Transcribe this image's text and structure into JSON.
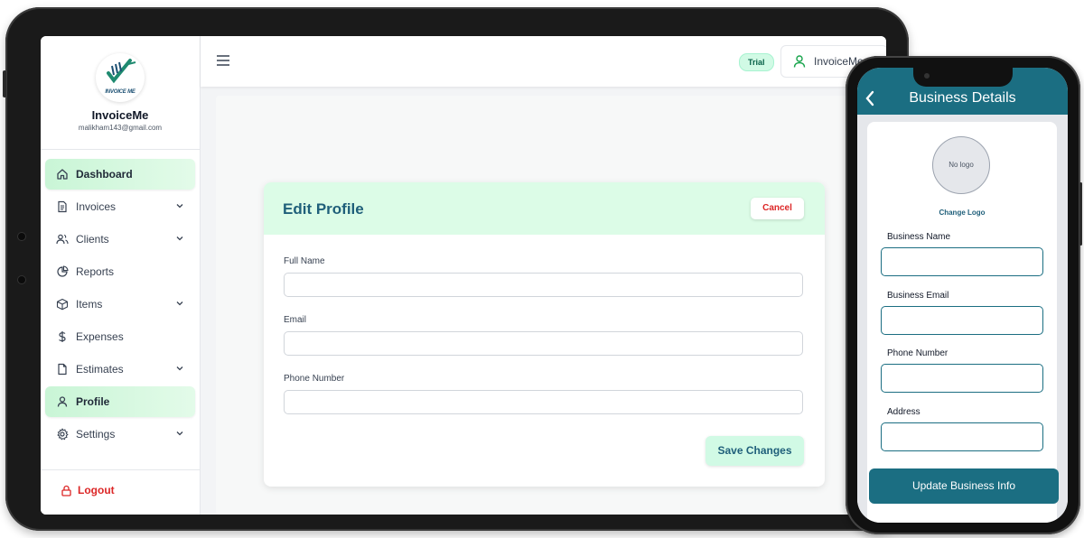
{
  "brand": {
    "logo_text": "INVOICE ME",
    "name": "InvoiceMe",
    "email": "malikham143@gmail.com"
  },
  "sidebar": {
    "items": [
      {
        "label": "Dashboard",
        "icon": "home-icon",
        "active": true,
        "has_submenu": false
      },
      {
        "label": "Invoices",
        "icon": "document-icon",
        "active": false,
        "has_submenu": true
      },
      {
        "label": "Clients",
        "icon": "users-icon",
        "active": false,
        "has_submenu": true
      },
      {
        "label": "Reports",
        "icon": "pie-chart-icon",
        "active": false,
        "has_submenu": false
      },
      {
        "label": "Items",
        "icon": "box-icon",
        "active": false,
        "has_submenu": true
      },
      {
        "label": "Expenses",
        "icon": "dollar-icon",
        "active": false,
        "has_submenu": false
      },
      {
        "label": "Estimates",
        "icon": "file-icon",
        "active": false,
        "has_submenu": true
      },
      {
        "label": "Profile",
        "icon": "user-icon",
        "active": true,
        "has_submenu": false
      },
      {
        "label": "Settings",
        "icon": "gear-icon",
        "active": false,
        "has_submenu": true
      }
    ],
    "logout_label": "Logout"
  },
  "topbar": {
    "badge": "Trial",
    "user_name": "InvoiceMe"
  },
  "edit_profile": {
    "title": "Edit Profile",
    "cancel_label": "Cancel",
    "fields": [
      {
        "label": "Full Name",
        "value": ""
      },
      {
        "label": "Email",
        "value": ""
      },
      {
        "label": "Phone Number",
        "value": ""
      }
    ],
    "save_label": "Save Changes"
  },
  "phone": {
    "title": "Business Details",
    "logo_placeholder": "No logo",
    "change_logo_label": "Change Logo",
    "fields": [
      {
        "label": "Business Name",
        "value": ""
      },
      {
        "label": "Business Email",
        "value": ""
      },
      {
        "label": "Phone Number",
        "value": ""
      },
      {
        "label": "Address",
        "value": ""
      }
    ],
    "update_label": "Update Business Info"
  },
  "colors": {
    "accent": "#1b6e82",
    "active_bg": "#d1fae5",
    "danger": "#dc2626"
  }
}
